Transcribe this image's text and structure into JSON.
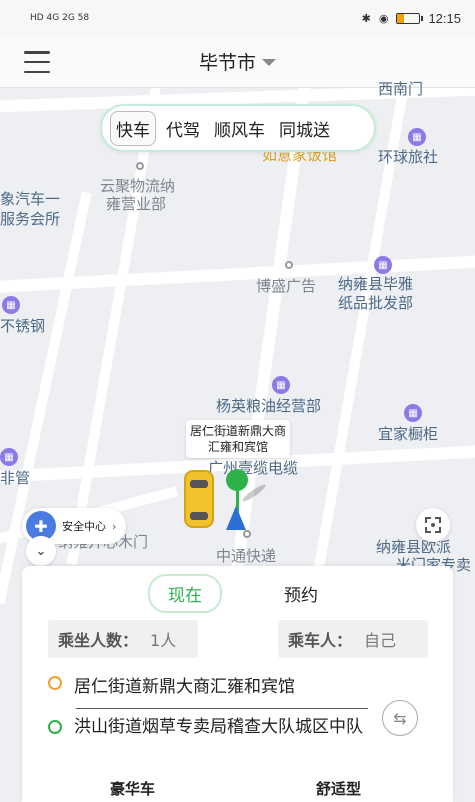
{
  "status_bar": {
    "left": "HD 4G 2G 58",
    "time": "12:15",
    "battery_fill": 0.3
  },
  "header": {
    "city": "毕节市"
  },
  "service_tabs": [
    "快车",
    "代驾",
    "顺风车",
    "同城送"
  ],
  "map": {
    "pois": {
      "p1": "西南门",
      "p2": "如意家饭馆",
      "p3": "环球旅社",
      "p4": "云聚物流纳",
      "p5": "雍营业部",
      "p6": "象汽车一",
      "p7": "服务会所",
      "p8": "博盛广告",
      "p9": "纳雍县毕雅",
      "p10": "纸品批发部",
      "p11": "不锈钢",
      "p12": "杨英粮油经营部",
      "p13": "宜家橱柜",
      "p14": "广州壹缆电缆",
      "p15": "非管",
      "p16": "纳雍开心木门",
      "p17": "中通快递",
      "p18": "纳雍县欧派",
      "p19": "米门家专卖"
    },
    "pickup_label": "居仁街道新鼎大商汇雍和宾馆",
    "safety_center": "安全中心"
  },
  "panel": {
    "time_tabs": [
      "现在",
      "预约"
    ],
    "passenger_count_label": "乘坐人数：",
    "passenger_count_value": "1人",
    "rider_label": "乘车人：",
    "rider_value": "自己",
    "from": "居仁街道新鼎大商汇雍和宾馆",
    "to": "洪山街道烟草专卖局稽查大队城区中队",
    "car_types": [
      "豪华车",
      "舒适型"
    ]
  },
  "colors": {
    "green": "#2db34a",
    "orange_dot": "#f0a030",
    "green_dot": "#2db34a",
    "taxi": "#f2c12e"
  }
}
